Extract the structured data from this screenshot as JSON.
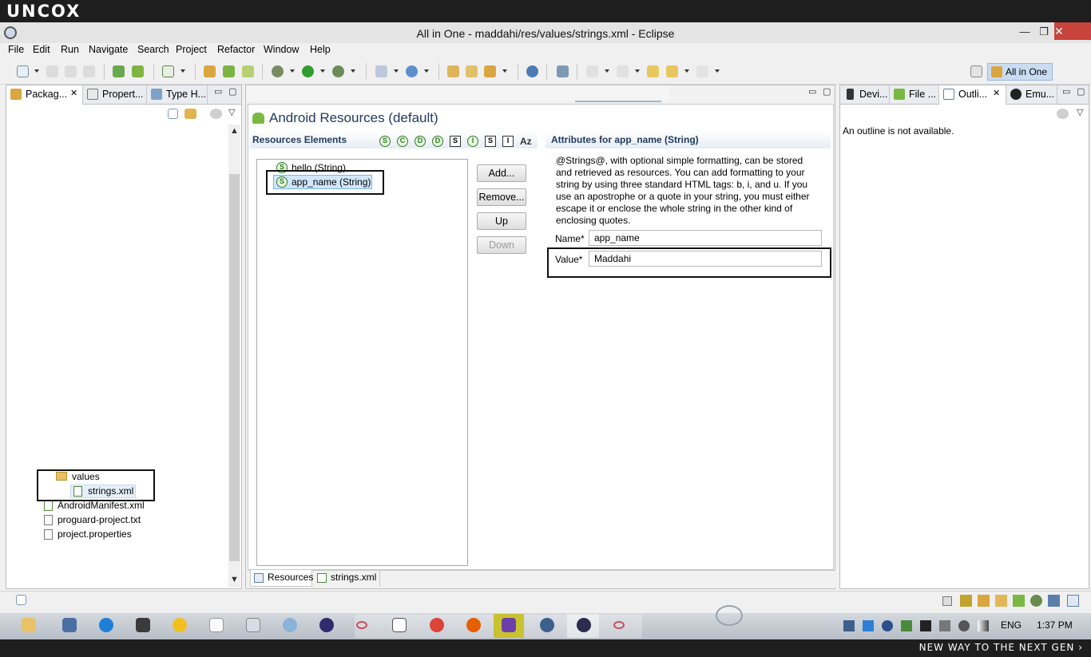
{
  "brand": {
    "logo": "UNCOX",
    "slogan": "NEW WAY TO THE NEXT GEN ›"
  },
  "window": {
    "title": "All in One - maddahi/res/values/strings.xml - Eclipse",
    "minimize": "—",
    "maximize": "❐",
    "close": "✕"
  },
  "menu": [
    "File",
    "Edit",
    "Run",
    "Navigate",
    "Search",
    "Project",
    "Refactor",
    "Window",
    "Help"
  ],
  "perspective": {
    "label": "All in One"
  },
  "left_panel": {
    "tabs": [
      "Packag...",
      "Propert...",
      "Type H..."
    ],
    "tree": {
      "folder": "values",
      "selected_file": "strings.xml",
      "files": [
        "AndroidManifest.xml",
        "proguard-project.txt",
        "project.properties"
      ]
    }
  },
  "editor": {
    "header": "Android Resources (default)",
    "elements_title": "Resources Elements",
    "type_icons": [
      "S",
      "C",
      "D",
      "D",
      "S",
      "I",
      "S",
      "I",
      "Az"
    ],
    "items": [
      "hello (String)",
      "app_name (String)"
    ],
    "buttons": {
      "add": "Add...",
      "remove": "Remove...",
      "up": "Up",
      "down": "Down"
    },
    "attributes_title": "Attributes for app_name (String)",
    "description": "@Strings@, with optional simple formatting, can be stored and retrieved as resources. You can add formatting to your string by using three standard HTML tags: b, i, and u. If you use an apostrophe or a quote in your string, you must either escape it or enclose the whole string in the other kind of enclosing quotes.",
    "name_label": "Name*",
    "name_value": "app_name",
    "value_label": "Value*",
    "value_value": "Maddahi",
    "bottom_tabs": [
      "Resources",
      "strings.xml"
    ]
  },
  "right_panel": {
    "tabs": [
      "Devi...",
      "File ...",
      "Outli...",
      "Emu..."
    ],
    "message": "An outline is not available."
  },
  "taskbar": {
    "lang": "ENG",
    "time": "1:37 PM"
  },
  "colors": {
    "title_close": "#c7433c",
    "android_green": "#7bb843",
    "selection": "#cfe6fb"
  }
}
